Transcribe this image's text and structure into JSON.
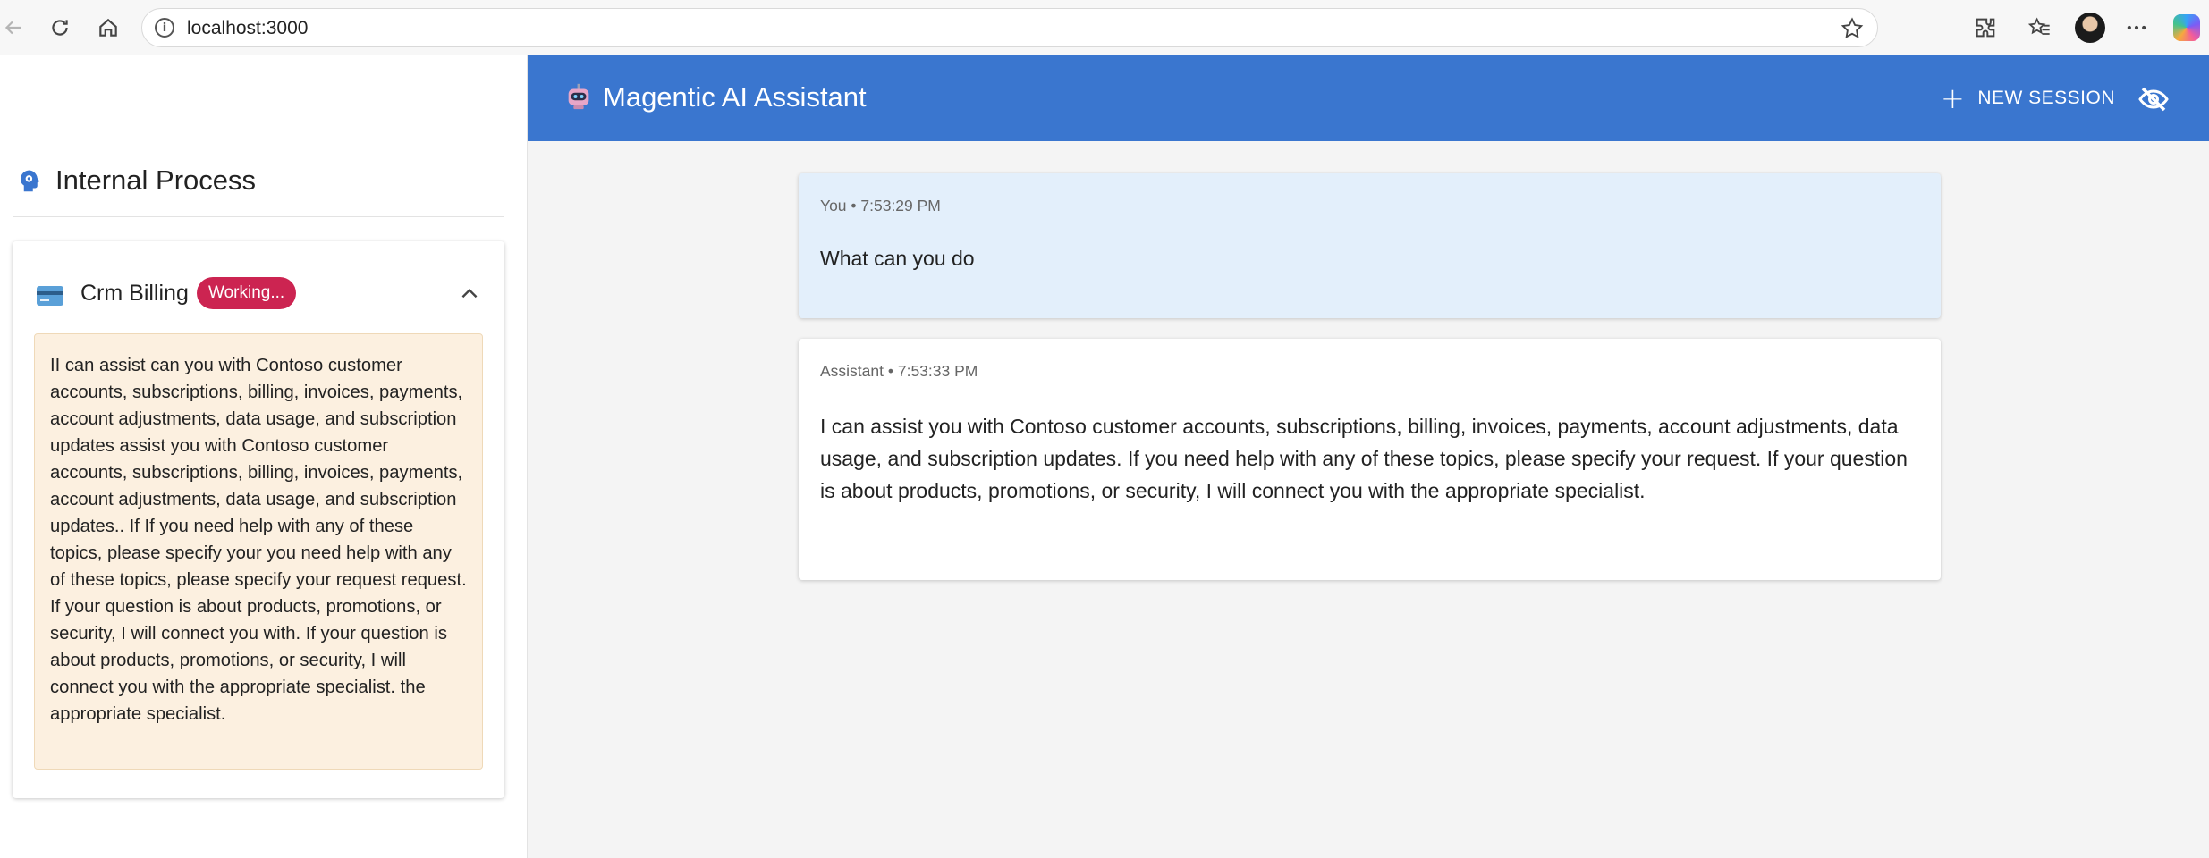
{
  "browser": {
    "url": "localhost:3000",
    "icons": [
      "back-icon",
      "refresh-icon",
      "home-icon",
      "info-icon",
      "favorite-star-icon",
      "extensions-icon",
      "favorites-icon",
      "profile-avatar",
      "more-icon",
      "copilot-icon"
    ]
  },
  "header": {
    "title": "Magentic AI Assistant",
    "new_session_label": "NEW SESSION",
    "accent": "#3a76cf"
  },
  "sidebar": {
    "title": "Internal Process",
    "agent": {
      "name": "Crm Billing",
      "status": "Working...",
      "status_color": "#cc2451",
      "stream_text": "II can assist can you with Contoso customer accounts, subscriptions, billing, invoices, payments, account adjustments, data usage, and subscription updates assist you with Contoso customer accounts, subscriptions, billing, invoices, payments, account adjustments, data usage, and subscription updates.. If If you need help with any of these topics, please specify your you need help with any of these topics, please specify your request request. If your question is about products, promotions, or security, I will connect you with. If your question is about products, promotions, or security, I will connect you with the appropriate specialist. the appropriate specialist."
    }
  },
  "messages": [
    {
      "meta": "You • 7:53:29 PM",
      "text": "What can you do"
    },
    {
      "meta": "Assistant • 7:53:33 PM",
      "text": "I can assist you with Contoso customer accounts, subscriptions, billing, invoices, payments, account adjustments, data usage, and subscription updates. If you need help with any of these topics, please specify your request. If your question is about products, promotions, or security, I will connect you with the appropriate specialist."
    }
  ]
}
